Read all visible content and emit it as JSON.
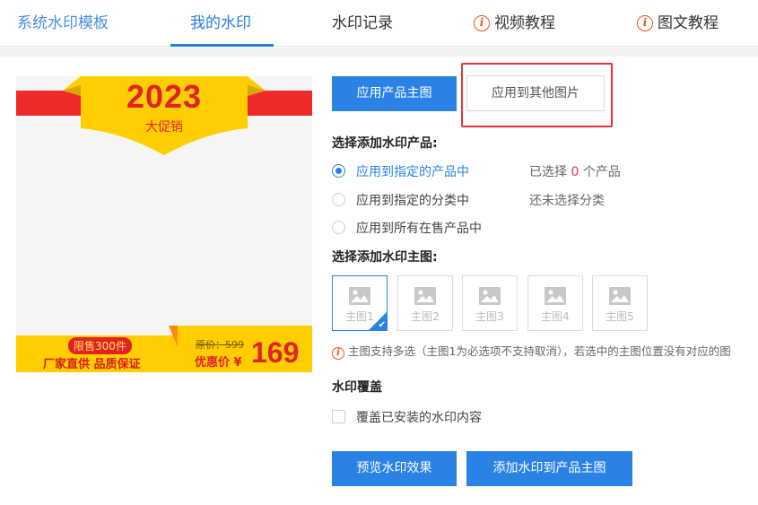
{
  "tabs": [
    {
      "label": "系统水印模板"
    },
    {
      "label": "我的水印"
    },
    {
      "label": "水印记录"
    },
    {
      "label": "视频教程",
      "icon": "info-icon"
    },
    {
      "label": "图文教程",
      "icon": "info-icon"
    }
  ],
  "active_tab": "我的水印",
  "preview": {
    "year": "2023",
    "promo": "大促销",
    "limit": "限售300件",
    "factory": "厂家直供 品质保证",
    "original_price": "原价：599",
    "deal_label": "优惠价 ¥",
    "price": "169"
  },
  "buttons": {
    "apply_main": "应用产品主图",
    "apply_other": "应用到其他图片",
    "preview": "预览水印效果",
    "add": "添加水印到产品主图"
  },
  "section_products": {
    "label": "选择添加水印产品:",
    "options": [
      {
        "label": "应用到指定的产品中",
        "selected": true
      },
      {
        "label": "应用到指定的分类中",
        "selected": false
      },
      {
        "label": "应用到所有在售产品中",
        "selected": false
      }
    ],
    "selected_prefix": "已选择",
    "selected_count": "0",
    "selected_suffix": "个产品",
    "category_status": "还未选择分类"
  },
  "section_images": {
    "label": "选择添加水印主图:",
    "thumbs": [
      {
        "label": "主图1",
        "selected": true
      },
      {
        "label": "主图2",
        "selected": false
      },
      {
        "label": "主图3",
        "selected": false
      },
      {
        "label": "主图4",
        "selected": false
      },
      {
        "label": "主图5",
        "selected": false
      }
    ],
    "note": "主图支持多选（主图1为必选项不支持取消），若选中的主图位置没有对应的图"
  },
  "section_cover": {
    "label": "水印覆盖",
    "checkbox_label": "覆盖已安装的水印内容",
    "checked": false
  },
  "colors": {
    "accent": "#2a82e4",
    "highlight": "#e53636",
    "promo_red": "#e0232a",
    "promo_yellow": "#ffcd00"
  }
}
